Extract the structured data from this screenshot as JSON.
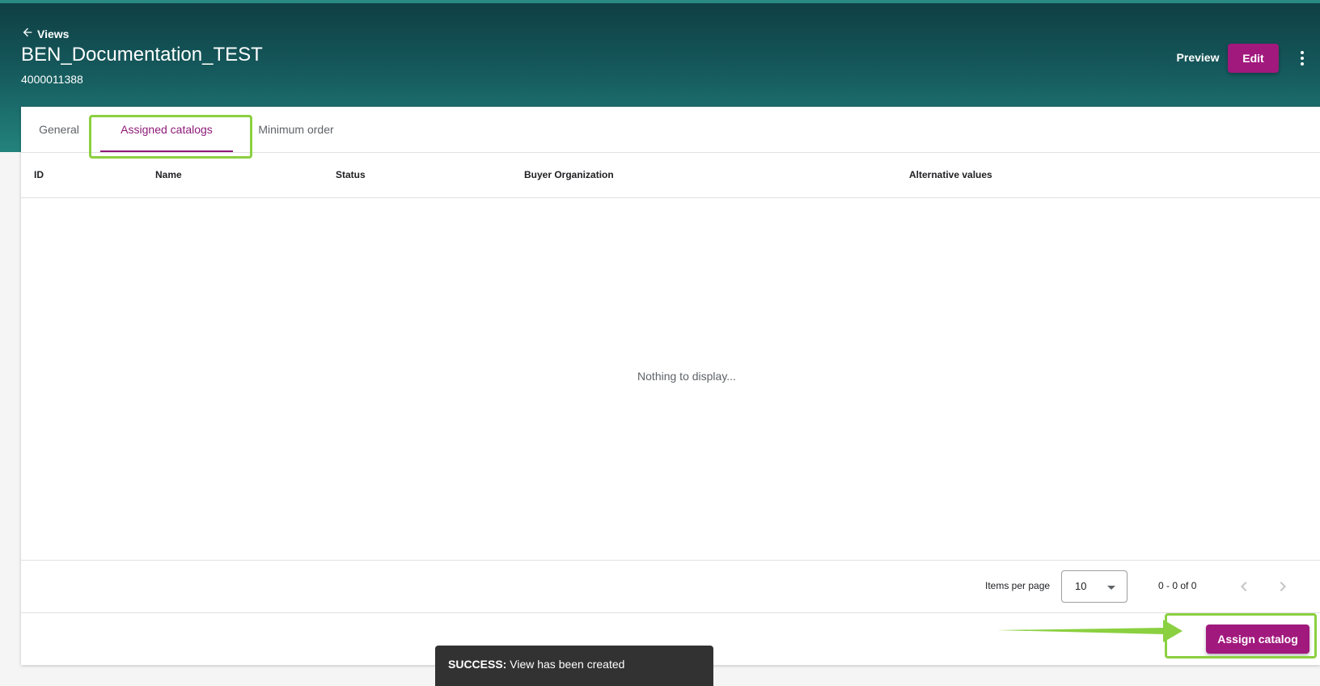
{
  "header": {
    "back_label": "Views",
    "title": "BEN_Documentation_TEST",
    "id": "4000011388",
    "preview_label": "Preview",
    "edit_label": "Edit"
  },
  "tabs": [
    {
      "label": "General"
    },
    {
      "label": "Assigned catalogs",
      "active": true
    },
    {
      "label": "Minimum order"
    }
  ],
  "table": {
    "columns": [
      "ID",
      "Name",
      "Status",
      "Buyer Organization",
      "Alternative values"
    ],
    "rows": [],
    "empty_message": "Nothing to display..."
  },
  "paginator": {
    "items_per_page_label": "Items per page",
    "items_per_page_value": "10",
    "range_label": "0 - 0 of 0"
  },
  "actions": {
    "assign_label": "Assign catalog"
  },
  "snackbar": {
    "prefix": "SUCCESS:",
    "message": "View has been created"
  },
  "colors": {
    "brand_purple": "#a1197d",
    "header_teal": "#15595c",
    "highlight_green": "#8bd040"
  },
  "icons": [
    "arrow-left-icon",
    "more-vert-icon",
    "chevron-down-icon",
    "chevron-left-icon",
    "chevron-right-icon"
  ]
}
